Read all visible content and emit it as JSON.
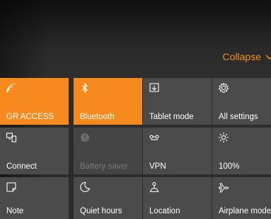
{
  "header": {
    "collapse_label": "Collapse"
  },
  "tiles": [
    {
      "label": "GR ACCESS",
      "icon": "wifi-icon",
      "state": "on"
    },
    {
      "label": "Bluetooth",
      "icon": "bluetooth-icon",
      "state": "on"
    },
    {
      "label": "Tablet mode",
      "icon": "tablet-mode-icon",
      "state": "off"
    },
    {
      "label": "All settings",
      "icon": "gear-icon",
      "state": "off"
    },
    {
      "label": "Connect",
      "icon": "connect-icon",
      "state": "off"
    },
    {
      "label": "Battery saver",
      "icon": "battery-saver-icon",
      "state": "disabled"
    },
    {
      "label": "VPN",
      "icon": "vpn-icon",
      "state": "off"
    },
    {
      "label": "100%",
      "icon": "brightness-icon",
      "state": "off"
    },
    {
      "label": "Note",
      "icon": "note-icon",
      "state": "off"
    },
    {
      "label": "Quiet hours",
      "icon": "moon-icon",
      "state": "off"
    },
    {
      "label": "Location",
      "icon": "location-icon",
      "state": "off"
    },
    {
      "label": "Airplane mode",
      "icon": "airplane-icon",
      "state": "off"
    }
  ],
  "colors": {
    "accent": "#f68a1e",
    "collapse_text": "#f7901e",
    "tile_off": "#4b4b4b",
    "tile_disabled_text": "#7a7a7a"
  }
}
